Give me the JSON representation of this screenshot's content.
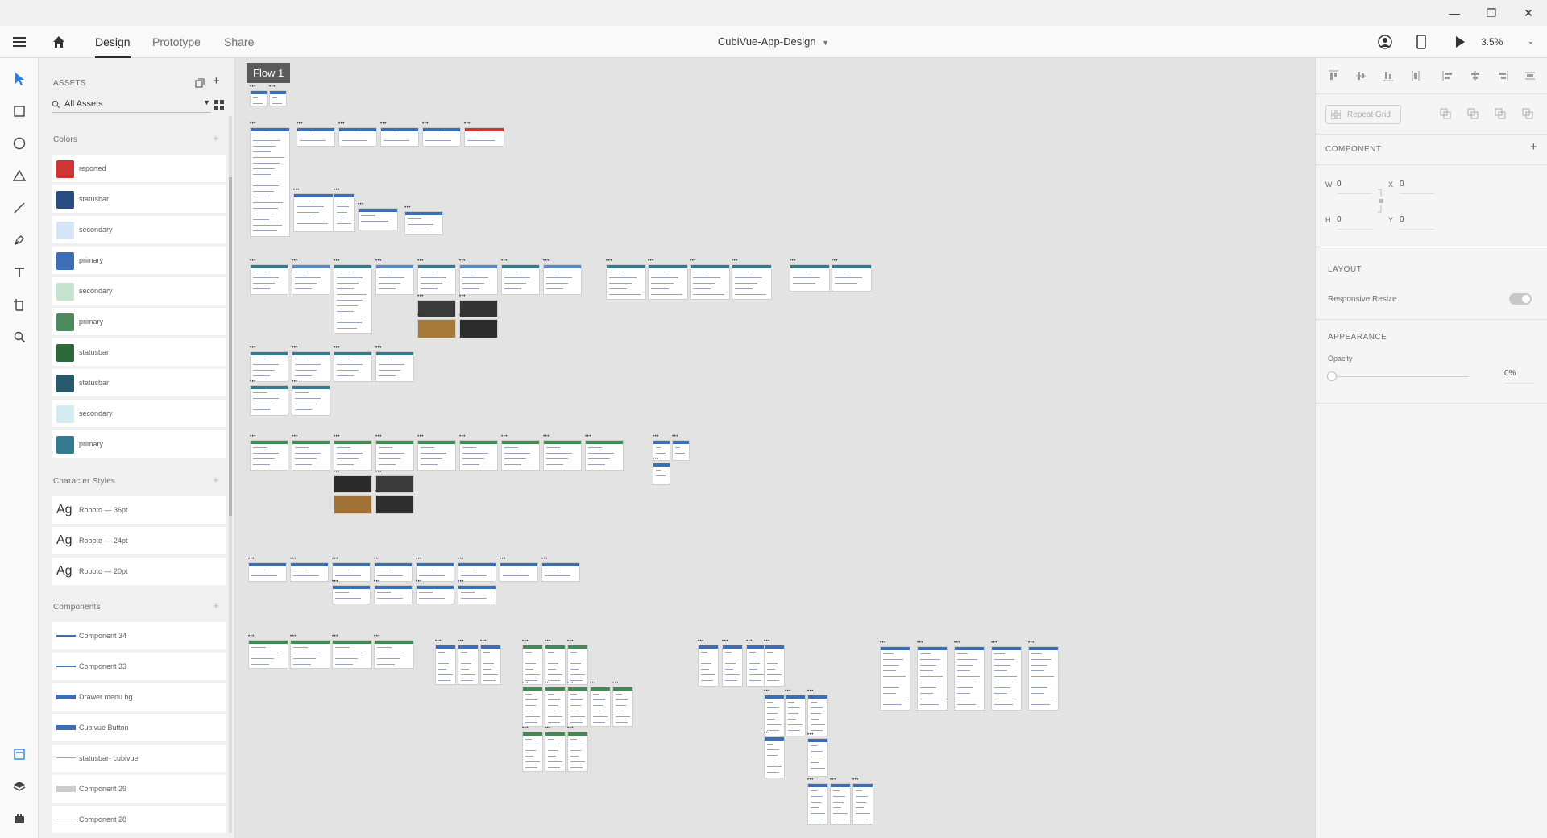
{
  "window": {
    "controls": {
      "minimize": "—",
      "restore": "❐",
      "close": "✕"
    }
  },
  "appbar": {
    "tabs": [
      "Design",
      "Prototype",
      "Share"
    ],
    "document_title": "CubiVue-App-Design",
    "zoom": "3.5%"
  },
  "assets": {
    "header": "ASSETS",
    "filter_value": "All Assets",
    "colors_title": "Colors",
    "colors": [
      {
        "name": "reported",
        "hex": "#d03435"
      },
      {
        "name": "statusbar",
        "hex": "#284b80"
      },
      {
        "name": "secondary",
        "hex": "#d5e4f7"
      },
      {
        "name": "primary",
        "hex": "#3d6db5"
      },
      {
        "name": "secondary",
        "hex": "#c5e3cf"
      },
      {
        "name": "primary",
        "hex": "#4d8a5e"
      },
      {
        "name": "statusbar",
        "hex": "#2c6a3c"
      },
      {
        "name": "statusbar",
        "hex": "#285a6e"
      },
      {
        "name": "secondary",
        "hex": "#d3ecf2"
      },
      {
        "name": "primary",
        "hex": "#347a8e"
      }
    ],
    "char_styles_title": "Character Styles",
    "char_styles": [
      {
        "sample": "Ag",
        "label": "Roboto — 36pt"
      },
      {
        "sample": "Ag",
        "label": "Roboto — 24pt"
      },
      {
        "sample": "Ag",
        "label": "Roboto — 20pt"
      }
    ],
    "components_title": "Components",
    "components": [
      "Component 34",
      "Component 33",
      "Drawer menu bg",
      "Cubivue Button",
      "statusbar- cubivue",
      "Component 29",
      "Component 28"
    ]
  },
  "canvas": {
    "flow_label": "Flow 1"
  },
  "props": {
    "repeat_grid_label": "Repeat Grid",
    "component_title": "COMPONENT",
    "w_label": "W",
    "w_value": "0",
    "h_label": "H",
    "h_value": "0",
    "x_label": "X",
    "x_value": "0",
    "y_label": "Y",
    "y_value": "0",
    "layout_title": "LAYOUT",
    "responsive_label": "Responsive Resize",
    "appearance_title": "APPEARANCE",
    "opacity_label": "Opacity",
    "opacity_value": "0%"
  }
}
